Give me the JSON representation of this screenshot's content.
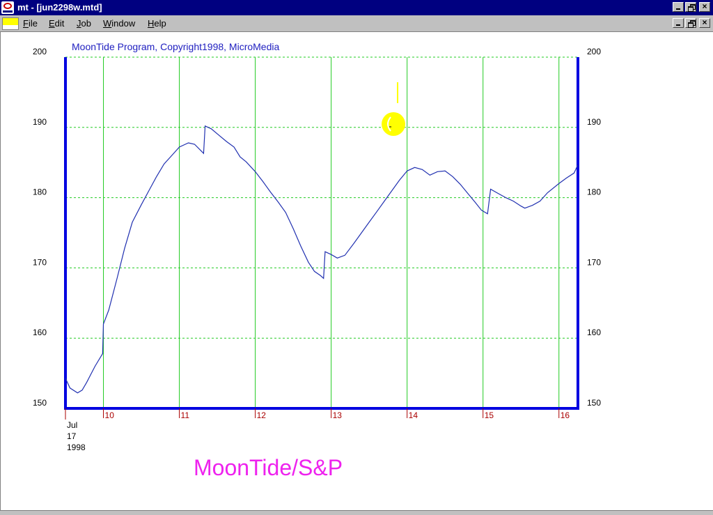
{
  "window": {
    "title": "mt - [jun2298w.mtd]"
  },
  "menu": {
    "items": [
      {
        "accel": "F",
        "rest": "ile"
      },
      {
        "accel": "E",
        "rest": "dit"
      },
      {
        "accel": "J",
        "rest": "ob"
      },
      {
        "accel": "W",
        "rest": "indow"
      },
      {
        "accel": "H",
        "rest": "elp"
      }
    ]
  },
  "icons": {
    "app": "moontide-app-icon",
    "document": "chart-document-icon",
    "minimize": "minimize-icon",
    "restore": "restore-icon",
    "close": "close-icon",
    "moon": "moon-phase-icon"
  },
  "chart": {
    "subtitle": "MoonTide Program, Copyright1998, MicroMedia",
    "watermark": "MoonTide/S&P",
    "date_label": {
      "month": "Jul",
      "day": "17",
      "year": "1998"
    }
  },
  "colors": {
    "frame": "#0000e0",
    "grid_h": "#22cc22",
    "grid_v": "#22cc22",
    "line": "#2030b0",
    "moon": "#ffff00",
    "moon_tick": "#ffff00",
    "xtick": "#aa0000",
    "watermark": "#ee22ee",
    "subtitle": "#2020c0"
  },
  "chart_data": {
    "type": "line",
    "ylim": [
      150,
      200
    ],
    "xlim": [
      9.5,
      16.25
    ],
    "y_ticks": [
      150,
      160,
      170,
      180,
      190,
      200
    ],
    "x_ticks": [
      10,
      11,
      12,
      13,
      14,
      15,
      16
    ],
    "x_tick_labels": [
      "10",
      "11",
      "12",
      "13",
      "14",
      "15",
      "16"
    ],
    "moon_x": 13.82,
    "series": [
      {
        "points": [
          [
            9.5,
            154.3
          ],
          [
            9.56,
            152.9
          ],
          [
            9.66,
            152.2
          ],
          [
            9.72,
            152.6
          ],
          [
            9.78,
            153.7
          ],
          [
            9.89,
            156.0
          ],
          [
            9.99,
            157.8
          ],
          [
            10.0,
            162.0
          ],
          [
            10.07,
            164.0
          ],
          [
            10.18,
            168.5
          ],
          [
            10.28,
            172.8
          ],
          [
            10.38,
            176.5
          ],
          [
            10.5,
            179.0
          ],
          [
            10.6,
            181.0
          ],
          [
            10.7,
            183.0
          ],
          [
            10.8,
            184.8
          ],
          [
            10.9,
            186.0
          ],
          [
            11.0,
            187.2
          ],
          [
            11.12,
            187.8
          ],
          [
            11.2,
            187.6
          ],
          [
            11.32,
            186.3
          ],
          [
            11.34,
            190.2
          ],
          [
            11.42,
            189.8
          ],
          [
            11.52,
            188.9
          ],
          [
            11.62,
            188.0
          ],
          [
            11.72,
            187.2
          ],
          [
            11.8,
            185.8
          ],
          [
            11.88,
            185.1
          ],
          [
            12.0,
            183.7
          ],
          [
            12.1,
            182.3
          ],
          [
            12.2,
            180.8
          ],
          [
            12.3,
            179.4
          ],
          [
            12.4,
            177.9
          ],
          [
            12.5,
            175.6
          ],
          [
            12.6,
            173.1
          ],
          [
            12.7,
            170.8
          ],
          [
            12.78,
            169.5
          ],
          [
            12.86,
            168.9
          ],
          [
            12.9,
            168.5
          ],
          [
            12.92,
            172.3
          ],
          [
            13.0,
            171.9
          ],
          [
            13.08,
            171.4
          ],
          [
            13.18,
            171.8
          ],
          [
            13.3,
            173.5
          ],
          [
            13.4,
            175.0
          ],
          [
            13.5,
            176.5
          ],
          [
            13.6,
            178.0
          ],
          [
            13.7,
            179.5
          ],
          [
            13.8,
            181.0
          ],
          [
            13.9,
            182.5
          ],
          [
            14.0,
            183.8
          ],
          [
            14.1,
            184.3
          ],
          [
            14.2,
            184.0
          ],
          [
            14.3,
            183.2
          ],
          [
            14.4,
            183.7
          ],
          [
            14.5,
            183.8
          ],
          [
            14.6,
            183.0
          ],
          [
            14.7,
            181.9
          ],
          [
            14.8,
            180.6
          ],
          [
            14.9,
            179.3
          ],
          [
            14.98,
            178.2
          ],
          [
            15.06,
            177.7
          ],
          [
            15.1,
            181.2
          ],
          [
            15.2,
            180.6
          ],
          [
            15.3,
            180.0
          ],
          [
            15.4,
            179.5
          ],
          [
            15.5,
            178.8
          ],
          [
            15.55,
            178.5
          ],
          [
            15.65,
            178.9
          ],
          [
            15.75,
            179.5
          ],
          [
            15.85,
            180.7
          ],
          [
            16.0,
            182.0
          ],
          [
            16.1,
            182.8
          ],
          [
            16.2,
            183.5
          ],
          [
            16.25,
            184.7
          ]
        ]
      }
    ]
  }
}
